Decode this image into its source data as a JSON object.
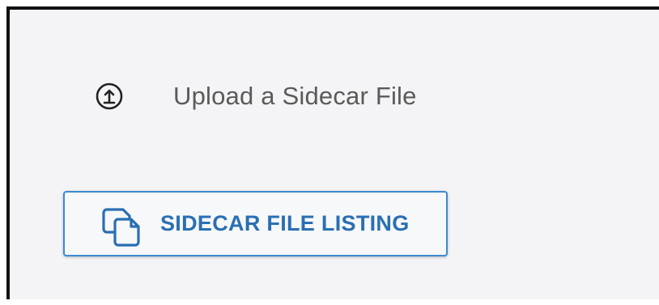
{
  "upload": {
    "icon": "upload-circle-icon",
    "label": "Upload a Sidecar File"
  },
  "listing_button": {
    "icon": "copy-files-icon",
    "label": "SIDECAR FILE LISTING"
  },
  "colors": {
    "panel_background": "#f4f4f6",
    "accent": "#2a6fb3",
    "button_border": "#3d8ad0",
    "text_muted": "#5a5a5a"
  }
}
